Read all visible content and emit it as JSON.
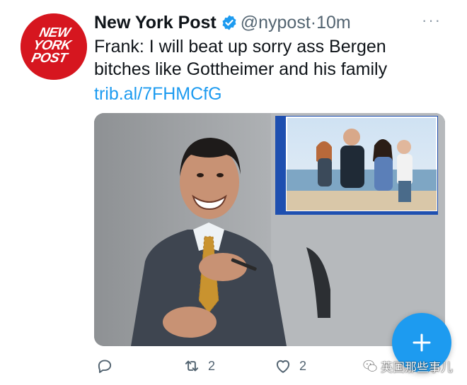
{
  "avatar": {
    "logo_text": "NEW YORK POST",
    "color": "#d6161f"
  },
  "header": {
    "display_name": "New York Post",
    "handle": "@nypost",
    "separator": "·",
    "time": "10m",
    "more_label": "···"
  },
  "tweet": {
    "text": "Frank: I will beat up sorry ass Bergen bitches like Gottheimer and his family",
    "link": "trib.al/7FHMCfG"
  },
  "actions": {
    "reply_count": "",
    "retweet_count": "2",
    "like_count": "2"
  },
  "fab": {
    "icon": "plus-icon",
    "color": "#1d9bf0"
  },
  "watermark": {
    "text": "英国那些事儿"
  },
  "colors": {
    "link": "#1d9bf0",
    "muted": "#536471",
    "verified": "#1d9bf0"
  }
}
